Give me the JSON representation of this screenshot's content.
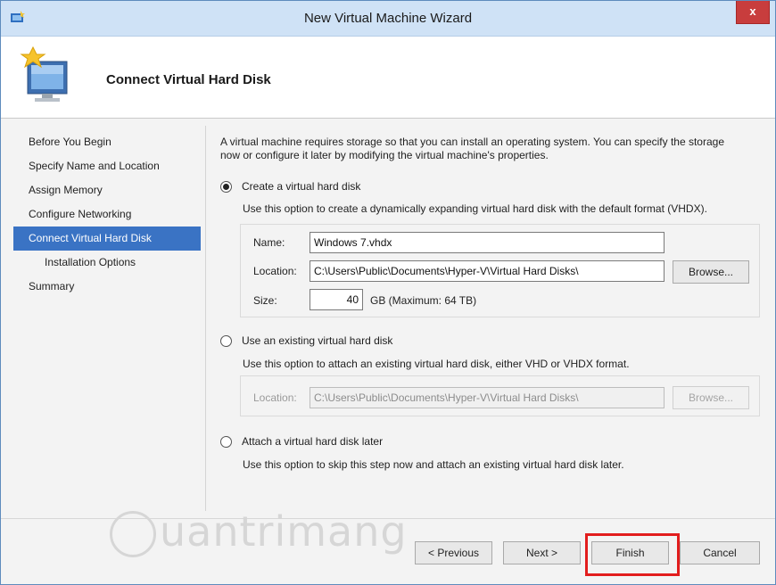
{
  "window": {
    "title": "New Virtual Machine Wizard",
    "close_label": "x"
  },
  "header": {
    "title": "Connect Virtual Hard Disk"
  },
  "nav": {
    "items": [
      {
        "label": "Before You Begin"
      },
      {
        "label": "Specify Name and Location"
      },
      {
        "label": "Assign Memory"
      },
      {
        "label": "Configure Networking"
      },
      {
        "label": "Connect Virtual Hard Disk",
        "active": true
      },
      {
        "label": "Installation Options",
        "sub": true
      },
      {
        "label": "Summary"
      }
    ]
  },
  "main": {
    "intro": "A virtual machine requires storage so that you can install an operating system. You can specify the storage now or configure it later by modifying the virtual machine's properties.",
    "option_create": {
      "label": "Create a virtual hard disk",
      "selected": true,
      "description": "Use this option to create a dynamically expanding virtual hard disk with the default format (VHDX).",
      "name_label": "Name:",
      "name_value": "Windows 7.vhdx",
      "location_label": "Location:",
      "location_value": "C:\\Users\\Public\\Documents\\Hyper-V\\Virtual Hard Disks\\",
      "browse_label": "Browse...",
      "size_label": "Size:",
      "size_value": "40",
      "size_unit": "GB (Maximum: 64 TB)"
    },
    "option_existing": {
      "label": "Use an existing virtual hard disk",
      "selected": false,
      "description": "Use this option to attach an existing virtual hard disk, either VHD or VHDX format.",
      "location_label": "Location:",
      "location_value": "C:\\Users\\Public\\Documents\\Hyper-V\\Virtual Hard Disks\\",
      "browse_label": "Browse..."
    },
    "option_later": {
      "label": "Attach a virtual hard disk later",
      "selected": false,
      "description": "Use this option to skip this step now and attach an existing virtual hard disk later."
    }
  },
  "footer": {
    "previous_label": "< Previous",
    "next_label": "Next >",
    "finish_label": "Finish",
    "cancel_label": "Cancel"
  },
  "watermark": {
    "text": "uantrimang"
  },
  "colors": {
    "titlebar": "#cfe2f6",
    "nav_active": "#3a73c4",
    "close_button": "#c83d3d",
    "highlight": "#e21d1d"
  }
}
